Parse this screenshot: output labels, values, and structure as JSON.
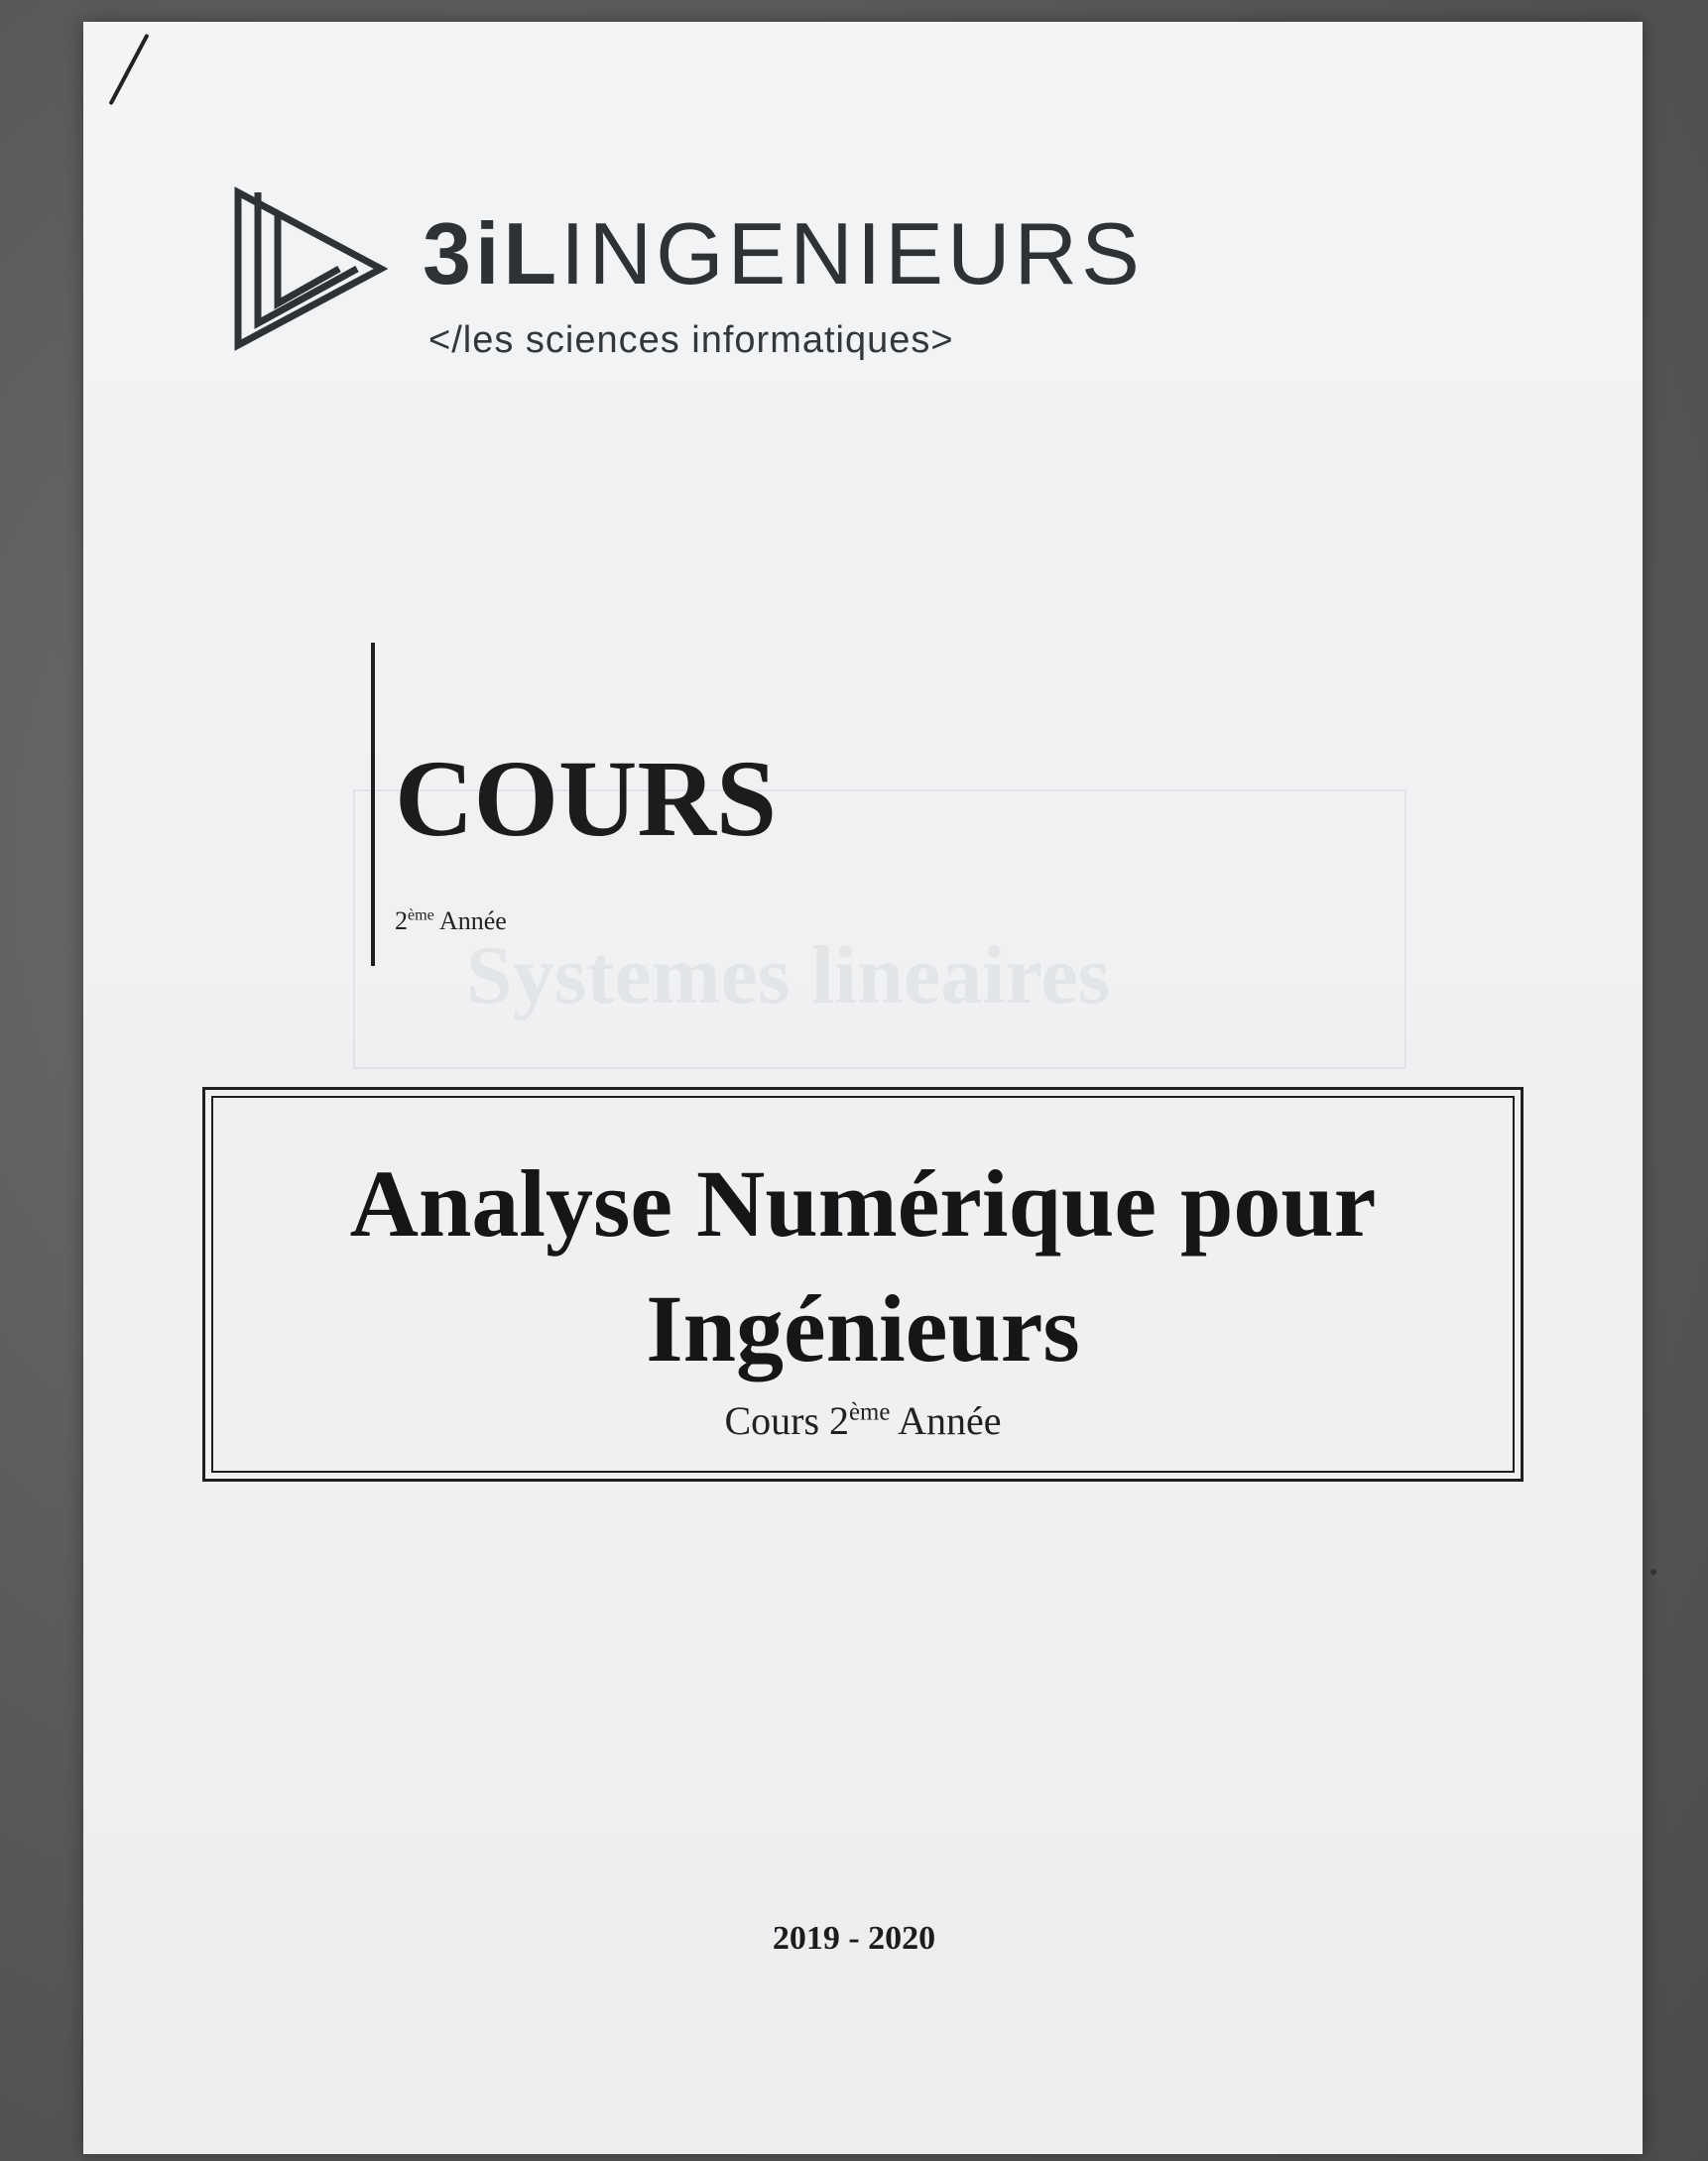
{
  "logo": {
    "brand_bold": "3iL",
    "brand_light": "INGENIEURS",
    "tagline": "</les sciences informatiques>",
    "icon": "triangle-play-logo-icon"
  },
  "cover": {
    "heading": "COURS",
    "year_number": "2",
    "year_suffix": "ème",
    "year_label": "Année"
  },
  "title_box": {
    "line1": "Analyse Numérique pour",
    "line2": "Ingénieurs",
    "subtitle_prefix": "Cours 2",
    "subtitle_suffix": "ème",
    "subtitle_label": "Année"
  },
  "footer": {
    "academic_year": "2019 - 2020"
  },
  "colors": {
    "ink": "#1b1c1e",
    "paper": "#f0f1f3",
    "background": "#58595b"
  }
}
